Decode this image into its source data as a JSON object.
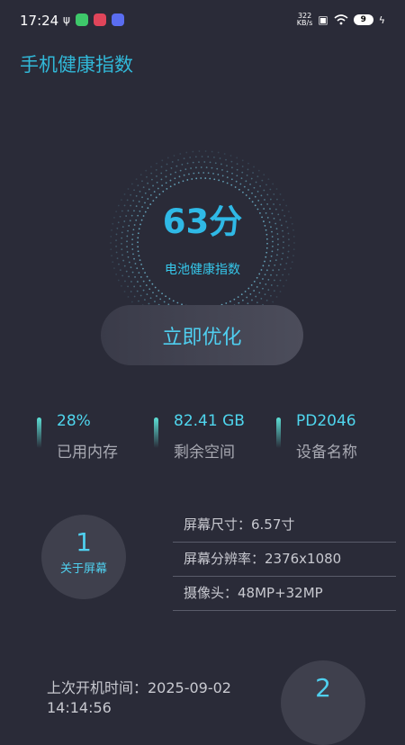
{
  "status_bar": {
    "time": "17:24",
    "speed_value": "322",
    "speed_unit": "KB/s",
    "battery": "9"
  },
  "page_title": "手机健康指数",
  "health": {
    "score": "63分",
    "label": "电池健康指数",
    "optimize_button": "立即优化"
  },
  "stats": [
    {
      "value": "28%",
      "label": "已用内存"
    },
    {
      "value": "82.41 GB",
      "label": "剩余空间"
    },
    {
      "value": "PD2046",
      "label": "设备名称"
    }
  ],
  "section1": {
    "number": "1",
    "caption": "关于屏幕",
    "lines": [
      "屏幕尺寸：6.57寸",
      "屏幕分辨率：2376x1080",
      "摄像头：48MP+32MP"
    ]
  },
  "section2": {
    "number": "2",
    "boot_label": "上次开机时间：2025-09-02",
    "boot_time": "14:14:56"
  },
  "colors": {
    "background": "#2a2b38",
    "accent": "#2fb9e6",
    "card": "#3f404d"
  }
}
